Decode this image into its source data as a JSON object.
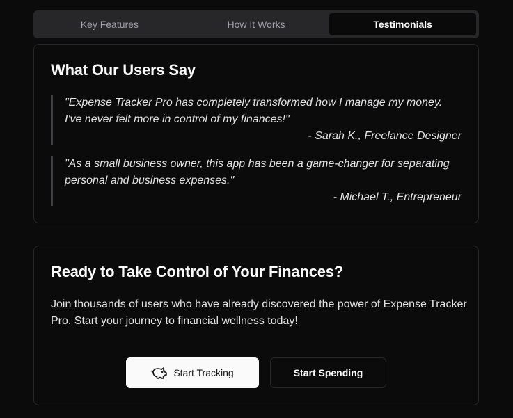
{
  "tabs": [
    {
      "label": "Key Features",
      "active": false
    },
    {
      "label": "How It Works",
      "active": false
    },
    {
      "label": "Testimonials",
      "active": true
    }
  ],
  "testimonials": {
    "title": "What Our Users Say",
    "items": [
      {
        "quote": "\"Expense Tracker Pro has completely transformed how I manage my money. I've never felt more in control of my finances!\"",
        "author": "- Sarah K., Freelance Designer"
      },
      {
        "quote": "\"As a small business owner, this app has been a game-changer for separating personal and business expenses.\"",
        "author": "- Michael T., Entrepreneur"
      }
    ]
  },
  "cta": {
    "title": "Ready to Take Control of Your Finances?",
    "description": "Join thousands of users who have already discovered the power of Expense Tracker Pro. Start your journey to financial wellness today!",
    "primary_button": {
      "label": "Start Tracking",
      "icon": "piggy-bank-icon"
    },
    "secondary_button": {
      "label": "Start Spending"
    }
  },
  "colors": {
    "background": "#0b0b0c",
    "border": "#27272a",
    "primary_button_bg": "#fafafa"
  }
}
